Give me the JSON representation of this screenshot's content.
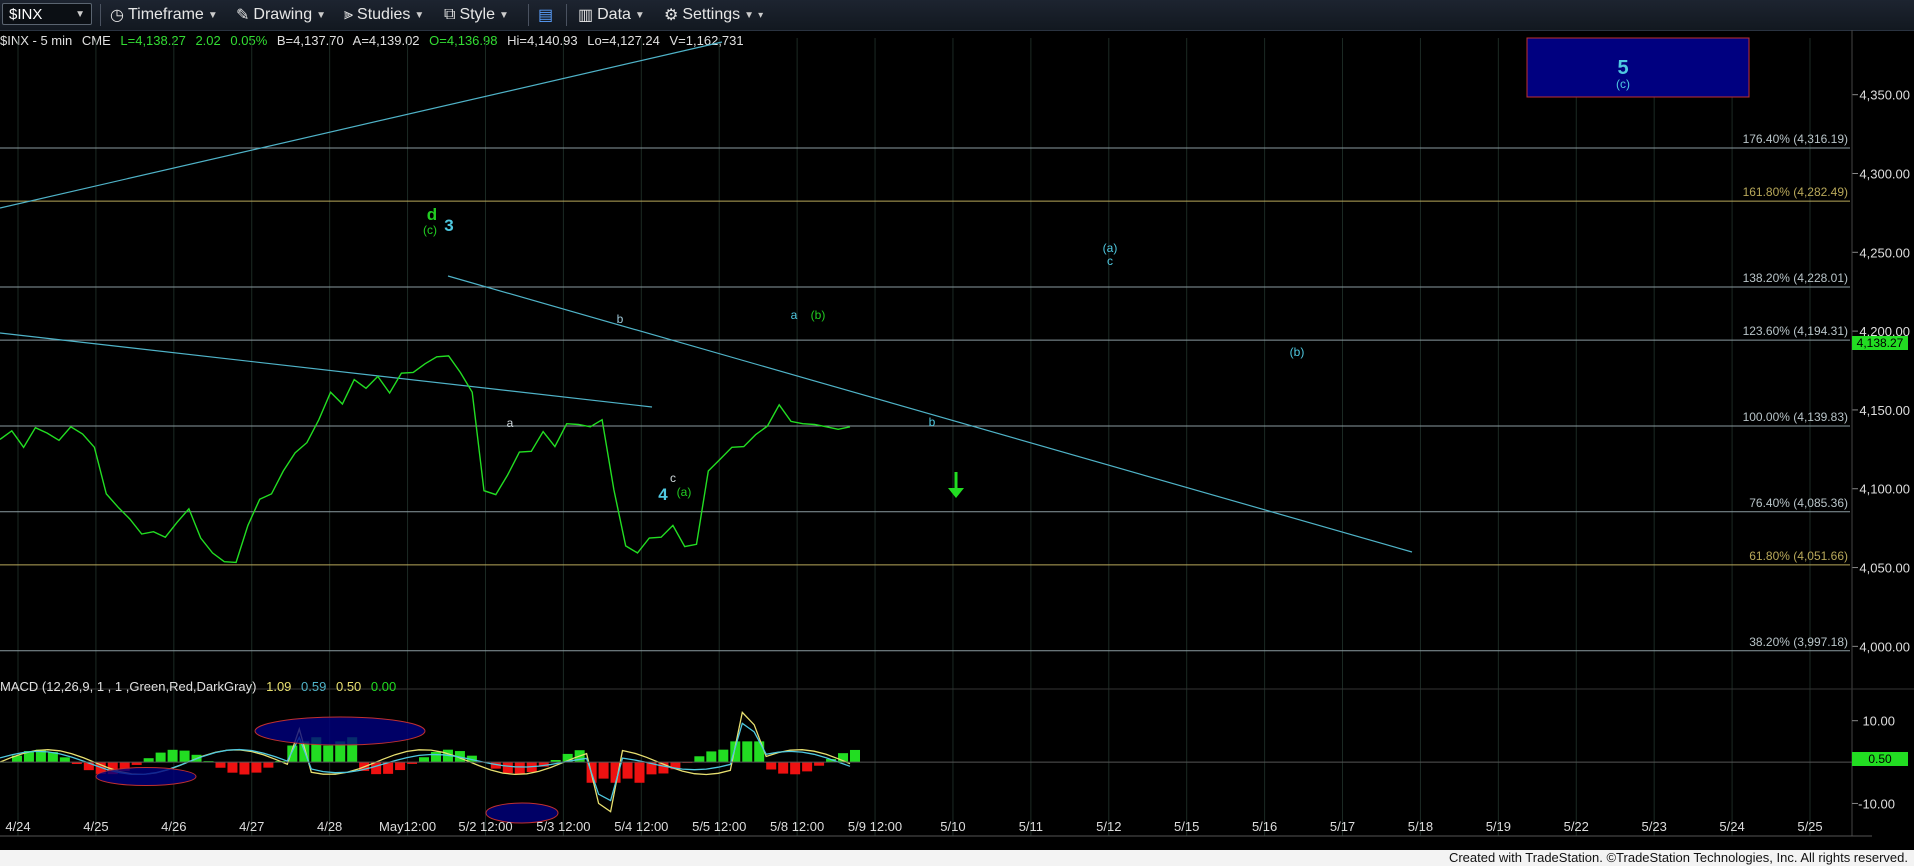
{
  "toolbar": {
    "symbol": "$INX",
    "timeframe": "Timeframe",
    "drawing": "Drawing",
    "studies": "Studies",
    "style": "Style",
    "data": "Data",
    "settings": "Settings"
  },
  "info": {
    "symbol": "$INX - 5 min",
    "exchange": "CME",
    "last": "L=4,138.27",
    "chg": "2.02",
    "pct": "0.05%",
    "bid": "B=4,137.70",
    "ask": "A=4,139.02",
    "open": "O=4,136.98",
    "hi": "Hi=4,140.93",
    "lo": "Lo=4,127.24",
    "vol": "V=1,162,731"
  },
  "macd": {
    "label": "MACD (12,26,9, 1 , 1 ,Green,Red,DarkGray)",
    "v1": "1.09",
    "v2": "0.59",
    "v3": "0.50",
    "v4": "0.00",
    "last_tag": "0.50",
    "ticks": [
      "10.00",
      "-10.00"
    ],
    "tick_values": [
      10,
      -10
    ],
    "ylim": [
      -14,
      15
    ]
  },
  "footer": "Created with TradeStation. ©TradeStation Technologies, Inc. All rights reserved.",
  "colors": {
    "price": "#22dd22",
    "trend": "#4fb3c8",
    "fib": "#8a9aa0",
    "fib_gold": "#b8a85a",
    "macd_pos": "#22dd22",
    "macd_neg": "#ee1111",
    "target_box": "#000080"
  },
  "chart_data": {
    "type": "line",
    "title": "$INX - 5 min",
    "ylim": [
      3985,
      4372
    ],
    "y_ticks": [
      4000,
      4050,
      4100,
      4150,
      4200,
      4250,
      4300,
      4350
    ],
    "y_tick_labels": [
      "4,000.00",
      "4,050.00",
      "4,100.00",
      "4,150.00",
      "4,200.00",
      "4,250.00",
      "4,300.00",
      "4,350.00"
    ],
    "x_tick_labels": [
      "4/24",
      "4/25",
      "4/26",
      "4/27",
      "4/28",
      "May12:00",
      "5/2 12:00",
      "5/3 12:00",
      "5/4 12:00",
      "5/5 12:00",
      "5/8 12:00",
      "5/9 12:00",
      "5/10",
      "5/11",
      "5/12",
      "5/15",
      "5/16",
      "5/17",
      "5/18",
      "5/19",
      "5/22",
      "5/23",
      "5/24",
      "5/25"
    ],
    "last_price": "4,138.27",
    "series": [
      {
        "values": [
          4130,
          4138,
          4125,
          4140,
          4134,
          4132,
          4138,
          4136,
          4125,
          4098,
          4087,
          4082,
          4070,
          4074,
          4068,
          4080,
          4086,
          4070,
          4058,
          4055,
          4052,
          4078,
          4092,
          4098,
          4110,
          4124,
          4128,
          4145,
          4160,
          4155,
          4168,
          4165,
          4170,
          4162,
          4172,
          4175,
          4178,
          4185,
          4183,
          4175,
          4160,
          4100,
          4095,
          4110,
          4122,
          4125,
          4135,
          4128,
          4140,
          4142,
          4138,
          4145,
          4098,
          4065,
          4058,
          4070,
          4068,
          4078,
          4062,
          4066,
          4110,
          4120,
          4125,
          4128,
          4133,
          4141,
          4152,
          4144,
          4140,
          4142,
          4138,
          4139,
          4138
        ]
      }
    ],
    "fib_levels": [
      {
        "label": "176.40% (4,316.19)",
        "value": 4316.19
      },
      {
        "label": "161.80% (4,282.49)",
        "value": 4282.49
      },
      {
        "label": "138.20% (4,228.01)",
        "value": 4228.01
      },
      {
        "label": "123.60% (4,194.31)",
        "value": 4194.31
      },
      {
        "label": "100.00% (4,139.83)",
        "value": 4139.83
      },
      {
        "label": "76.40% (4,085.36)",
        "value": 4085.36
      },
      {
        "label": "61.80% (4,051.66)",
        "value": 4051.66
      },
      {
        "label": "38.20% (3,997.18)",
        "value": 3997.18
      }
    ],
    "wave_labels": [
      {
        "text": "d",
        "style": "green-big"
      },
      {
        "text": "(c)",
        "style": "green-small"
      },
      {
        "text": "3",
        "style": "cyan-big"
      },
      {
        "text": "a",
        "style": "small"
      },
      {
        "text": "b",
        "style": "small"
      },
      {
        "text": "c",
        "style": "small"
      },
      {
        "text": "4",
        "style": "cyan-big"
      },
      {
        "text": "(a)",
        "style": "green-small"
      },
      {
        "text": "a",
        "style": "cyan-small"
      },
      {
        "text": "(b)",
        "style": "green-small"
      },
      {
        "text": "b",
        "style": "cyan-small"
      },
      {
        "text": "(a)",
        "style": "cyan-small"
      },
      {
        "text": "c",
        "style": "cyan-small"
      },
      {
        "text": "(b)",
        "style": "cyan-small"
      },
      {
        "text": "5",
        "style": "cyan-big"
      },
      {
        "text": "(c)",
        "style": "cyan-small"
      }
    ]
  }
}
